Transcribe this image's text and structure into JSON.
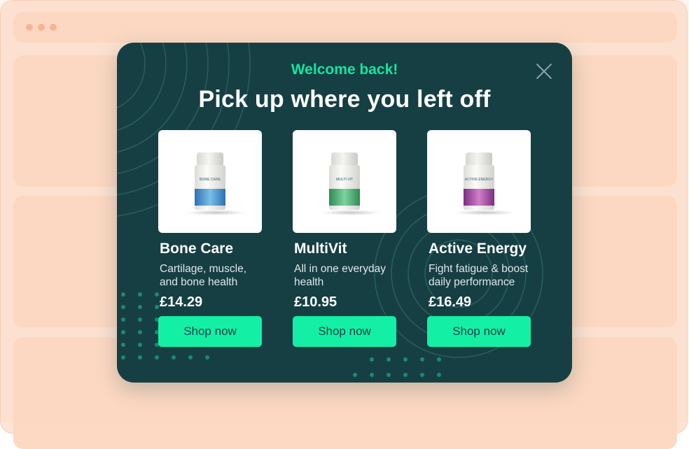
{
  "modal": {
    "welcome": "Welcome back!",
    "headline": "Pick up where you left off",
    "close_icon": "close-icon",
    "accent_color": "#13f0a6",
    "background_color": "#163f44"
  },
  "products": [
    {
      "name": "Bone Care",
      "description": "Cartilage, muscle, and bone health",
      "price": "£14.29",
      "button": "Shop now",
      "label_color": "#3a7fc1",
      "bottle_label": "BONE CARE"
    },
    {
      "name": "MultiVit",
      "description": "All in one everyday health",
      "price": "£10.95",
      "button": "Shop now",
      "label_color": "#3aa86a",
      "bottle_label": "MULTI VIT"
    },
    {
      "name": "Active Energy",
      "description": "Fight fatigue & boost daily performance",
      "price": "£16.49",
      "button": "Shop now",
      "label_color": "#9b3f9d",
      "bottle_label": "ACTIVE ENERGY"
    }
  ]
}
